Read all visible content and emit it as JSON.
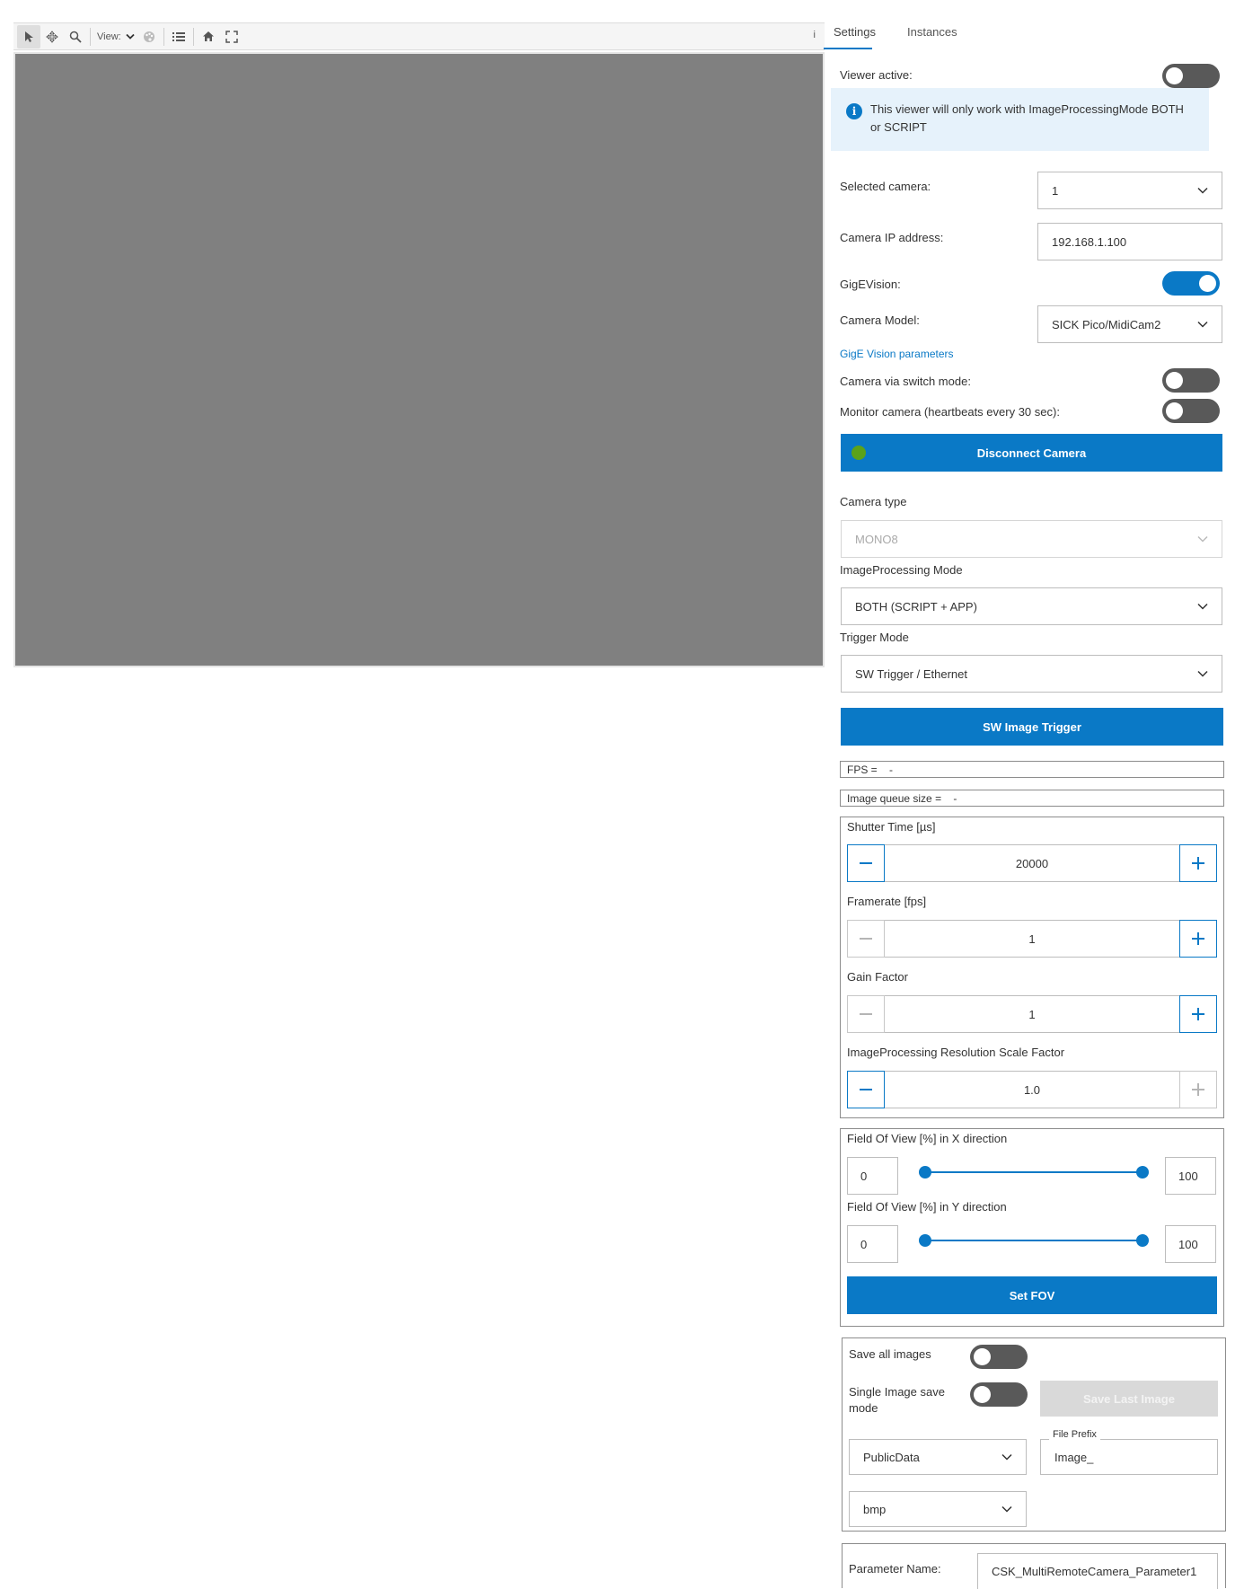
{
  "toolbar": {
    "view_label": "View:",
    "info_label": "i",
    "icons": [
      "pointer-icon",
      "pan-icon",
      "zoom-icon",
      "palette-icon",
      "list-icon",
      "home-icon",
      "fullscreen-icon"
    ]
  },
  "tabs": [
    {
      "label": "Settings",
      "active": true
    },
    {
      "label": "Instances",
      "active": false
    }
  ],
  "settings": {
    "viewer_active_label": "Viewer active:",
    "viewer_active": false,
    "info_text": "This viewer will only work with ImageProcessingMode BOTH or SCRIPT",
    "selected_camera_label": "Selected camera:",
    "selected_camera_value": "1",
    "camera_ip_label": "Camera IP address:",
    "camera_ip_value": "192.168.1.100",
    "gige_label": "GigEVision:",
    "gige_on": true,
    "camera_model_label": "Camera Model:",
    "camera_model_value": "SICK Pico/MidiCam2",
    "gige_params_link": "GigE Vision parameters",
    "switch_mode_label": "Camera via switch mode:",
    "switch_mode_on": false,
    "monitor_label": "Monitor camera (heartbeats every 30 sec):",
    "monitor_on": false,
    "disconnect_label": "Disconnect Camera",
    "connection_status_color": "#5ba21a",
    "camera_type_label": "Camera type",
    "camera_type_value": "MONO8",
    "ip_mode_label": "ImageProcessing Mode",
    "ip_mode_value": "BOTH (SCRIPT + APP)",
    "trigger_mode_label": "Trigger Mode",
    "trigger_mode_value": "SW Trigger / Ethernet",
    "sw_trigger_label": "SW Image Trigger",
    "fps_text": "FPS =    -",
    "queue_text": "Image queue size =    -",
    "shutter_label": "Shutter Time [µs]",
    "shutter_value": "20000",
    "framerate_label": "Framerate [fps]",
    "framerate_value": "1",
    "gain_label": "Gain Factor",
    "gain_value": "1",
    "scale_label": "ImageProcessing Resolution Scale Factor",
    "scale_value": "1.0",
    "fov_x_label": "Field Of View [%] in X direction",
    "fov_x_min": "0",
    "fov_x_max": "100",
    "fov_y_label": "Field Of View [%] in Y direction",
    "fov_y_min": "0",
    "fov_y_max": "100",
    "set_fov_label": "Set FOV",
    "save_all_label": "Save all images",
    "save_all_on": false,
    "single_save_label": "Single Image save mode",
    "single_save_on": false,
    "save_last_label": "Save Last Image",
    "file_prefix_label": "File Prefix",
    "file_prefix_value": "Image_",
    "storage_value": "PublicData",
    "format_value": "bmp",
    "param_name_label": "Parameter Name:",
    "param_name_value": "CSK_MultiRemoteCamera_Parameter1"
  },
  "colors": {
    "accent": "#0a79c6",
    "viewer_bg": "#808080",
    "toggle_off": "#595959",
    "info_bg": "#e6f2fb"
  }
}
